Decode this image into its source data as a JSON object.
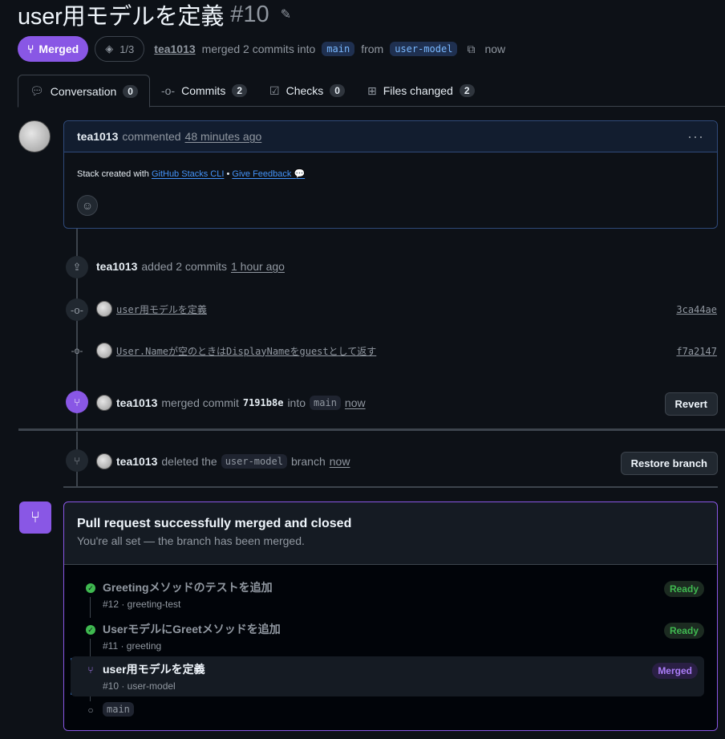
{
  "header": {
    "title": "user用モデルを定義",
    "number": "#10",
    "status": "Merged",
    "stack_position": "1/3",
    "author": "tea1013",
    "merge_text": "merged 2 commits into",
    "base_branch": "main",
    "from_text": "from",
    "head_branch": "user-model",
    "time": "now"
  },
  "tabs": [
    {
      "label": "Conversation",
      "count": "0"
    },
    {
      "label": "Commits",
      "count": "2"
    },
    {
      "label": "Checks",
      "count": "0"
    },
    {
      "label": "Files changed",
      "count": "2"
    }
  ],
  "comment": {
    "author": "tea1013",
    "action": "commented",
    "time": "48 minutes ago",
    "body_prefix": "Stack created with",
    "link1": "GitHub Stacks CLI",
    "separator": "•",
    "link2": "Give Feedback 💬"
  },
  "timeline": {
    "added": {
      "author": "tea1013",
      "text": "added 2 commits",
      "time": "1 hour ago"
    },
    "commits": [
      {
        "message": "user用モデルを定義",
        "sha": "3ca44ae"
      },
      {
        "message": "User.Nameが空のときはDisplayNameをguestとして返す",
        "sha": "f7a2147"
      }
    ],
    "merged": {
      "author": "tea1013",
      "text": "merged commit",
      "sha": "7191b8e",
      "into": "into",
      "branch": "main",
      "time": "now",
      "button": "Revert"
    },
    "deleted": {
      "author": "tea1013",
      "text": "deleted the",
      "branch": "user-model",
      "suffix": "branch",
      "time": "now",
      "button": "Restore branch"
    }
  },
  "merge_box": {
    "title": "Pull request successfully merged and closed",
    "subtitle": "You're all set — the branch has been merged.",
    "stack": [
      {
        "title": "Greetingメソッドのテストを追加",
        "sub": "#12 · greeting-test",
        "badge": "Ready"
      },
      {
        "title": "UserモデルにGreetメソッドを追加",
        "sub": "#11 · greeting",
        "badge": "Ready"
      },
      {
        "title": "user用モデルを定義",
        "sub": "#10 · user-model",
        "badge": "Merged"
      }
    ],
    "base": "main"
  }
}
